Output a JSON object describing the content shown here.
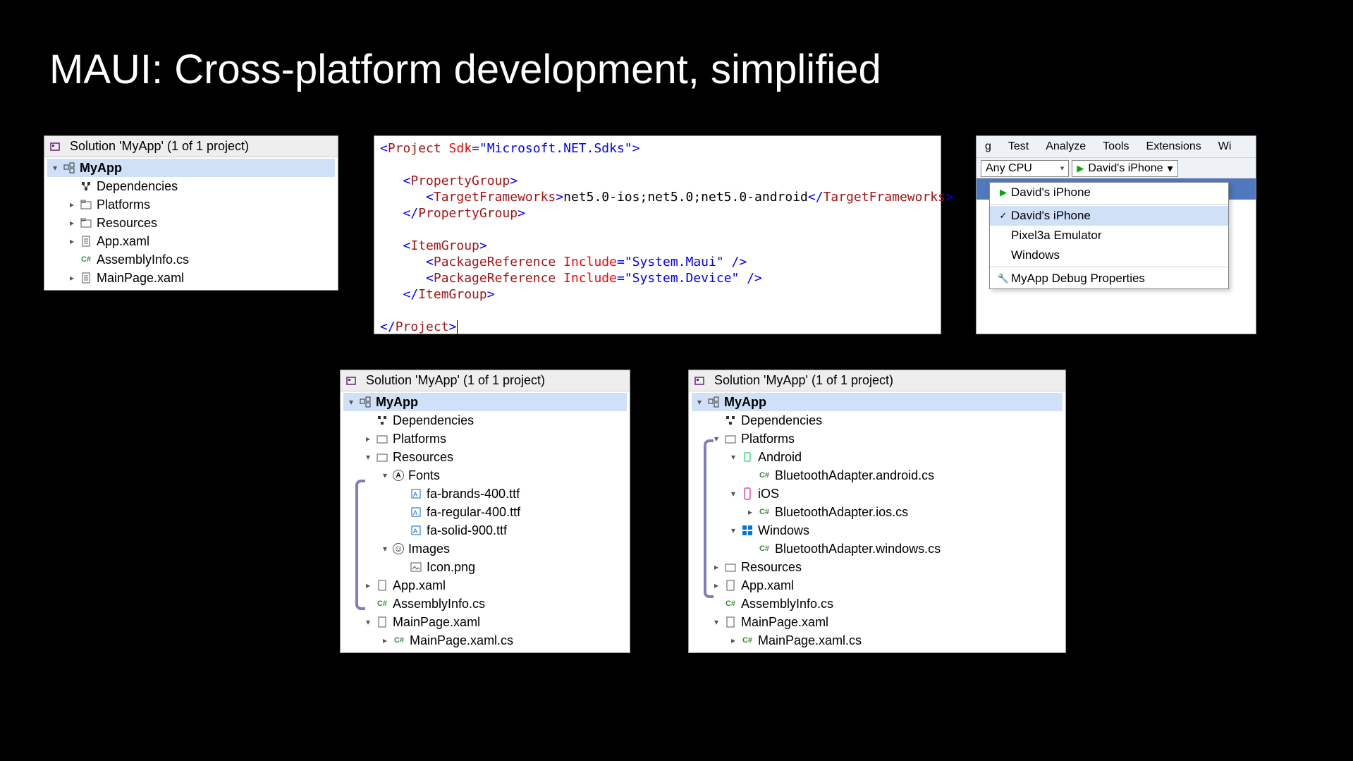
{
  "title": "MAUI: Cross-platform development, simplified",
  "se1": {
    "header": "Solution 'MyApp' (1 of 1 project)",
    "project": "MyApp",
    "items": {
      "dependencies": "Dependencies",
      "platforms": "Platforms",
      "resources": "Resources",
      "appxaml": "App.xaml",
      "assemblyinfo": "AssemblyInfo.cs",
      "mainpage": "MainPage.xaml"
    }
  },
  "code": {
    "line1a": "<",
    "line1_tag": "Project",
    "line1_sp": " ",
    "line1_attr": "Sdk",
    "line1_eq": "=",
    "line1_val": "\"Microsoft.NET.Sdks\"",
    "line1b": ">",
    "pg_open_a": "<",
    "pg_open": "PropertyGroup",
    "pg_open_b": ">",
    "tf_open_a": "<",
    "tf_open": "TargetFrameworks",
    "tf_open_b": ">",
    "tf_val": "net5.0-ios;net5.0;net5.0-android",
    "tf_close_a": "</",
    "tf_close": "TargetFrameworks",
    "tf_close_b": ">",
    "pg_close_a": "</",
    "pg_close": "PropertyGroup",
    "pg_close_b": ">",
    "ig_open_a": "<",
    "ig_open": "ItemGroup",
    "ig_open_b": ">",
    "pr1_a": "<",
    "pr1_tag": "PackageReference",
    "pr1_sp": " ",
    "pr1_attr": "Include",
    "pr1_eq": "=",
    "pr1_val": "\"System.Maui\"",
    "pr1_end": " />",
    "pr2_a": "<",
    "pr2_tag": "PackageReference",
    "pr2_sp": " ",
    "pr2_attr": "Include",
    "pr2_eq": "=",
    "pr2_val": "\"System.Device\"",
    "pr2_end": " />",
    "ig_close_a": "</",
    "ig_close": "ItemGroup",
    "ig_close_b": ">",
    "proj_close_a": "</",
    "proj_close": "Project",
    "proj_close_b": ">"
  },
  "toolbar": {
    "menu": {
      "g_frag": "g",
      "test": "Test",
      "analyze": "Analyze",
      "tools": "Tools",
      "extensions": "Extensions",
      "wi_frag": "Wi"
    },
    "cpu": "Any CPU",
    "target": "David's iPhone",
    "dropdown": {
      "item1": "David's iPhone",
      "item2": "David's iPhone",
      "item3": "Pixel3a Emulator",
      "item4": "Windows",
      "props": "MyApp Debug Properties"
    }
  },
  "se2": {
    "header": "Solution 'MyApp' (1 of 1 project)",
    "project": "MyApp",
    "dependencies": "Dependencies",
    "platforms": "Platforms",
    "resources": "Resources",
    "fonts": "Fonts",
    "font1": "fa-brands-400.ttf",
    "font2": "fa-regular-400.ttf",
    "font3": "fa-solid-900.ttf",
    "images": "Images",
    "icon": "Icon.png",
    "appxaml": "App.xaml",
    "assemblyinfo": "AssemblyInfo.cs",
    "mainpage": "MainPage.xaml",
    "mainpagecs": "MainPage.xaml.cs"
  },
  "se3": {
    "header": "Solution 'MyApp' (1 of 1 project)",
    "project": "MyApp",
    "dependencies": "Dependencies",
    "platforms": "Platforms",
    "android": "Android",
    "android_file": "BluetoothAdapter.android.cs",
    "ios": "iOS",
    "ios_file": "BluetoothAdapter.ios.cs",
    "windows": "Windows",
    "windows_file": "BluetoothAdapter.windows.cs",
    "resources": "Resources",
    "appxaml": "App.xaml",
    "assemblyinfo": "AssemblyInfo.cs",
    "mainpage": "MainPage.xaml",
    "mainpagecs": "MainPage.xaml.cs"
  }
}
